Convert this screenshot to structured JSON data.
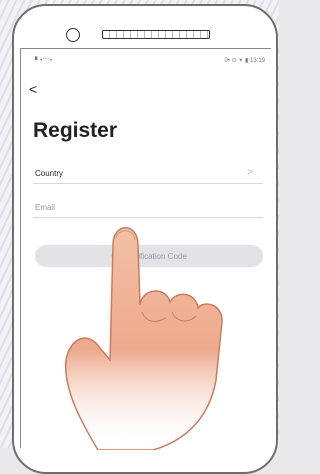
{
  "status_bar": {
    "signal_text": "▘•‘’‘’•",
    "right_text": "0• ⊙ ✴ ▮ 13:19"
  },
  "nav": {
    "back_label": "<"
  },
  "page": {
    "title": "Register"
  },
  "form": {
    "country_label": "Country",
    "country_chevron": ">",
    "email_placeholder": "Email",
    "button_label": "Get Verification Code"
  },
  "colors": {
    "title": "#222222",
    "button_bg": "#e3e3e6",
    "button_text": "#9c9ca0",
    "hand_skin": "#f2b39a"
  }
}
